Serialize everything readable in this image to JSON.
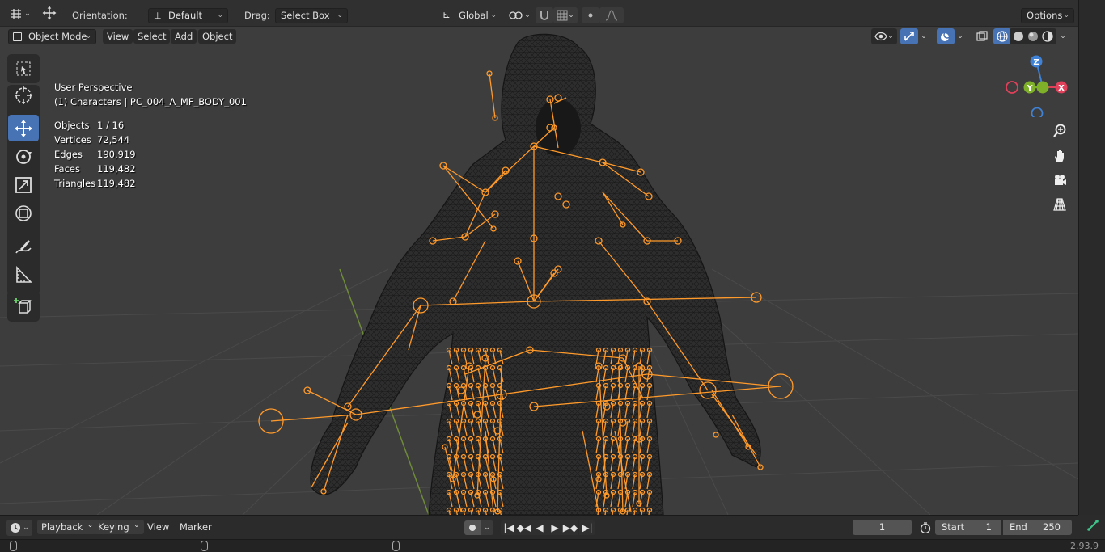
{
  "topbar": {
    "orientation_label": "Orientation:",
    "orientation_value": "Default",
    "drag_label": "Drag:",
    "drag_value": "Select Box",
    "transform_space": "Global",
    "options_label": "Options"
  },
  "header": {
    "mode": "Object Mode",
    "menus": [
      "View",
      "Select",
      "Add",
      "Object"
    ]
  },
  "viewport": {
    "view_name": "User Perspective",
    "object_name": "(1) Characters | PC_004_A_MF_BODY_001",
    "stats": [
      {
        "label": "Objects",
        "value": "1 / 16"
      },
      {
        "label": "Vertices",
        "value": "72,544"
      },
      {
        "label": "Edges",
        "value": "190,919"
      },
      {
        "label": "Faces",
        "value": "119,482"
      },
      {
        "label": "Triangles",
        "value": "119,482"
      }
    ],
    "gizmo": {
      "z": "Z",
      "y": "Y",
      "x": "X"
    }
  },
  "timeline": {
    "menus": [
      "Playback",
      "Keying",
      "View",
      "Marker"
    ],
    "current_frame": "1",
    "start_label": "Start",
    "start_value": "1",
    "end_label": "End",
    "end_value": "250"
  },
  "status": {
    "version": "2.93.9"
  },
  "colors": {
    "accent": "#4772b3",
    "armature": "#ff9a2b",
    "viewport_bg": "#3d3d3d",
    "axis_x": "#e0405a",
    "axis_y": "#7fb02a",
    "axis_z": "#3f82d6"
  },
  "icons": {
    "tools": [
      "select-box-icon",
      "cursor-icon",
      "move-icon",
      "rotate-icon",
      "scale-icon",
      "transform-icon",
      "annotate-icon",
      "measure-icon",
      "add-cube-icon"
    ],
    "nav": [
      "zoom-icon",
      "pan-hand-icon",
      "camera-icon",
      "perspective-grid-icon"
    ],
    "properties": [
      "tool-icon",
      "render-icon",
      "output-icon",
      "view-layer-icon",
      "scene-icon",
      "world-icon",
      "collection-icon",
      "object-icon",
      "modifier-icon",
      "particles-icon",
      "physics-icon",
      "constraints-icon",
      "data-icon"
    ]
  }
}
